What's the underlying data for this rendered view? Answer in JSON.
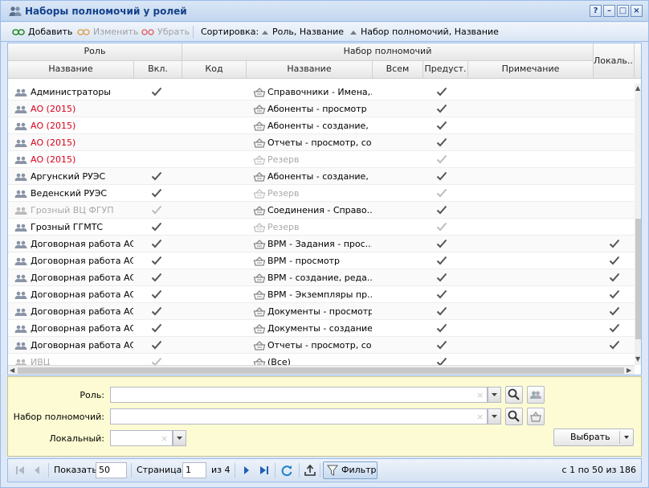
{
  "window": {
    "title": "Наборы полномочий у ролей"
  },
  "toolbar": {
    "add": "Добавить",
    "edit": "Изменить",
    "remove": "Убрать",
    "sort_label": "Сортировка:",
    "sort1": "Роль, Название",
    "sort2": "Набор полномочий, Название"
  },
  "grid": {
    "group_role": "Роль",
    "group_set": "Набор полномочий",
    "col_name": "Название",
    "col_enabled": "Вкл.",
    "col_code": "Код",
    "col_set_name": "Название",
    "col_all": "Всем",
    "col_preset": "Предуст.",
    "col_note": "Примечание",
    "col_local": "Локаль...",
    "rows": [
      {
        "role": "Администраторы",
        "style": "normal",
        "enabled": true,
        "set": "Справочники - Имена,...",
        "set_gray": false,
        "preset": true,
        "preset_gray": false,
        "local": false
      },
      {
        "role": "АО (2015)",
        "style": "red",
        "enabled": false,
        "set": "Абоненты - просмотр",
        "set_gray": false,
        "preset": true,
        "preset_gray": false,
        "local": false
      },
      {
        "role": "АО (2015)",
        "style": "red",
        "enabled": false,
        "set": "Абоненты - создание, ...",
        "set_gray": false,
        "preset": true,
        "preset_gray": false,
        "local": false
      },
      {
        "role": "АО (2015)",
        "style": "red",
        "enabled": false,
        "set": "Отчеты - просмотр, со...",
        "set_gray": false,
        "preset": true,
        "preset_gray": false,
        "local": false
      },
      {
        "role": "АО (2015)",
        "style": "red",
        "enabled": false,
        "set": "Резерв",
        "set_gray": true,
        "preset": true,
        "preset_gray": true,
        "local": false
      },
      {
        "role": "Аргунский РУЭС",
        "style": "normal",
        "enabled": true,
        "set": "Абоненты - создание, ...",
        "set_gray": false,
        "preset": true,
        "preset_gray": false,
        "local": false
      },
      {
        "role": "Веденский РУЭС",
        "style": "normal",
        "enabled": true,
        "set": "Резерв",
        "set_gray": true,
        "preset": true,
        "preset_gray": true,
        "local": false
      },
      {
        "role": "Грозный ВЦ ФГУП",
        "style": "gray",
        "enabled": true,
        "enabled_gray": true,
        "set": "Соединения - Справо...",
        "set_gray": false,
        "preset": true,
        "preset_gray": false,
        "local": false
      },
      {
        "role": "Грозный ГГМТС",
        "style": "normal",
        "enabled": true,
        "set": "Резерв",
        "set_gray": true,
        "preset": true,
        "preset_gray": true,
        "local": false
      },
      {
        "role": "Договорная работа АСВ",
        "style": "normal",
        "enabled": true,
        "set": "ВРМ - Задания - прос...",
        "set_gray": false,
        "preset": true,
        "preset_gray": false,
        "local": true
      },
      {
        "role": "Договорная работа АСВ",
        "style": "normal",
        "enabled": true,
        "set": "ВРМ - просмотр",
        "set_gray": false,
        "preset": true,
        "preset_gray": false,
        "local": true
      },
      {
        "role": "Договорная работа АСВ",
        "style": "normal",
        "enabled": true,
        "set": "ВРМ - создание, реда...",
        "set_gray": false,
        "preset": true,
        "preset_gray": false,
        "local": true
      },
      {
        "role": "Договорная работа АСВ",
        "style": "normal",
        "enabled": true,
        "set": "ВРМ - Экземпляры пр...",
        "set_gray": false,
        "preset": true,
        "preset_gray": false,
        "local": true
      },
      {
        "role": "Договорная работа АСВ",
        "style": "normal",
        "enabled": true,
        "set": "Документы - просмотр",
        "set_gray": false,
        "preset": true,
        "preset_gray": false,
        "local": true
      },
      {
        "role": "Договорная работа АСВ",
        "style": "normal",
        "enabled": true,
        "set": "Документы - создание...",
        "set_gray": false,
        "preset": true,
        "preset_gray": false,
        "local": true
      },
      {
        "role": "Договорная работа АСВ",
        "style": "normal",
        "enabled": true,
        "set": "Отчеты - просмотр, со...",
        "set_gray": false,
        "preset": true,
        "preset_gray": false,
        "local": true
      },
      {
        "role": "ИВЦ",
        "style": "gray",
        "enabled": true,
        "enabled_gray": true,
        "set": "(Все)",
        "set_gray": false,
        "preset": true,
        "preset_gray": false,
        "local": false
      }
    ]
  },
  "filters": {
    "role_label": "Роль:",
    "set_label": "Набор полномочий:",
    "local_label": "Локальный:",
    "role_value": "",
    "set_value": "",
    "local_value": "",
    "choose": "Выбрать"
  },
  "paging": {
    "show_label": "Показать",
    "page_size": "50",
    "page_label": "Страница",
    "page": "1",
    "of_label": "из 4",
    "filter": "Фильтр",
    "summary": "с 1 по 50 из 186"
  }
}
